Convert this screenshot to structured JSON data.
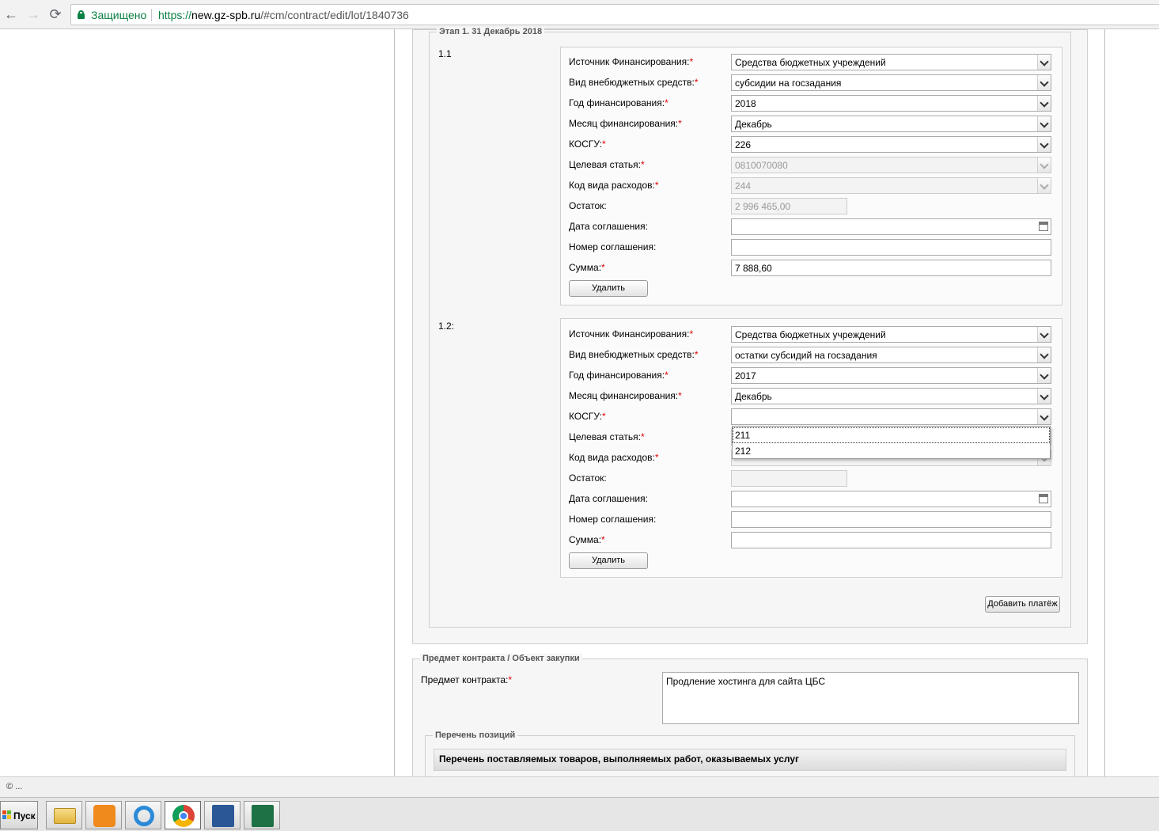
{
  "browser": {
    "back_glyph": "←",
    "forward_glyph": "→",
    "reload_glyph": "⟳",
    "secure_label": "Защищено",
    "url_scheme": "https://",
    "url_host": "new.gz-spb.ru",
    "url_path": "/#cm/contract/edit/lot/1840736"
  },
  "stage": {
    "legend": "Этап 1. 31 Декабрь 2018",
    "payments": [
      {
        "number": "1.1",
        "fields": {
          "source_label": "Источник Финансирования:",
          "source_value": "Средства бюджетных учреждений",
          "offbudget_label": "Вид внебюджетных средств:",
          "offbudget_value": "субсидии на госзадания",
          "year_label": "Год финансирования:",
          "year_value": "2018",
          "month_label": "Месяц финансирования:",
          "month_value": "Декабрь",
          "kosgu_label": "КОСГУ:",
          "kosgu_value": "226",
          "target_label": "Целевая статья:",
          "target_value": "0810070080",
          "expense_label": "Код вида расходов:",
          "expense_value": "244",
          "balance_label": "Остаток:",
          "balance_value": "2 996 465,00",
          "agreement_date_label": "Дата соглашения:",
          "agreement_date_value": "",
          "agreement_number_label": "Номер соглашения:",
          "agreement_number_value": "",
          "sum_label": "Сумма:",
          "sum_value": "7 888,60"
        },
        "delete_label": "Удалить"
      },
      {
        "number": "1.2:",
        "fields": {
          "source_label": "Источник Финансирования:",
          "source_value": "Средства бюджетных учреждений",
          "offbudget_label": "Вид внебюджетных средств:",
          "offbudget_value": "остатки субсидий на госзадания",
          "year_label": "Год финансирования:",
          "year_value": "2017",
          "month_label": "Месяц финансирования:",
          "month_value": "Декабрь",
          "kosgu_label": "КОСГУ:",
          "kosgu_value": "",
          "target_label": "Целевая статья:",
          "target_value": "",
          "expense_label": "Код вида расходов:",
          "expense_value": "",
          "balance_label": "Остаток:",
          "balance_value": "",
          "agreement_date_label": "Дата соглашения:",
          "agreement_date_value": "",
          "agreement_number_label": "Номер соглашения:",
          "agreement_number_value": "",
          "sum_label": "Сумма:",
          "sum_value": ""
        },
        "delete_label": "Удалить",
        "kosgu_dropdown_options": [
          "211",
          "212"
        ]
      }
    ],
    "add_payment_label": "Добавить платёж"
  },
  "subject": {
    "legend": "Предмет контракта / Объект закупки",
    "subject_label": "Предмет контракта:",
    "subject_value": "Продление хостинга для сайта ЦБС",
    "positions_legend": "Перечень позиций",
    "table_header": "Перечень поставляемых товаров, выполняемых работ, оказываемых услуг"
  },
  "required_mark": "*",
  "status_bar_text": "© ...",
  "taskbar": {
    "start_label": "Пуск",
    "apps": [
      "file-explorer",
      "pdf-reader",
      "internet-explorer",
      "chrome",
      "word",
      "excel"
    ],
    "active_app": "chrome"
  },
  "colors": {
    "secure_green": "#0b8043",
    "required_red": "#e00000"
  }
}
